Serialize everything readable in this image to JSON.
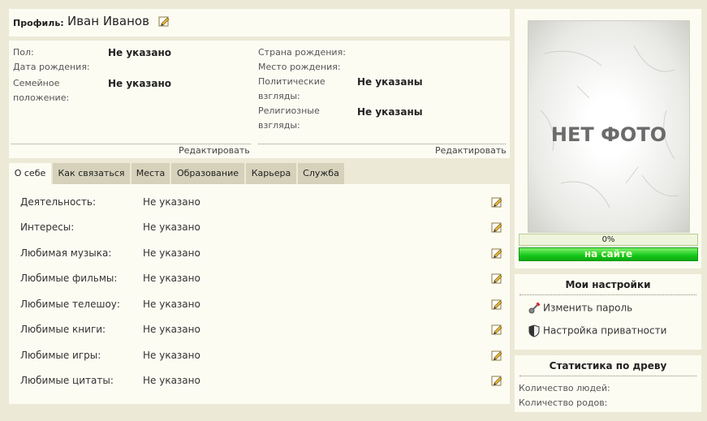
{
  "header": {
    "label": "Профиль:",
    "name": "Иван Иванов"
  },
  "info": {
    "left": [
      {
        "label": "Пол:",
        "value": "Не указано"
      },
      {
        "label": "Дата рождения:",
        "value": ""
      },
      {
        "label": "Семейное положение:",
        "value": "Не указано"
      }
    ],
    "right": [
      {
        "label": "Страна рождения:",
        "value": ""
      },
      {
        "label": "Место рождения:",
        "value": ""
      },
      {
        "label": "Политические взгляды:",
        "value": "Не указаны"
      },
      {
        "label": "Религиозные взгляды:",
        "value": "Не указаны"
      }
    ],
    "edit_left": "Редактировать",
    "edit_right": "Редактировать"
  },
  "tabs": [
    "О себе",
    "Как связаться",
    "Места",
    "Образование",
    "Карьера",
    "Служба"
  ],
  "about": [
    {
      "label": "Деятельность:",
      "value": "Не указано"
    },
    {
      "label": "Интересы:",
      "value": "Не указано"
    },
    {
      "label": "Любимая музыка:",
      "value": "Не указано"
    },
    {
      "label": "Любимые фильмы:",
      "value": "Не указано"
    },
    {
      "label": "Любимые телешоу:",
      "value": "Не указано"
    },
    {
      "label": "Любимые книги:",
      "value": "Не указано"
    },
    {
      "label": "Любимые игры:",
      "value": "Не указано"
    },
    {
      "label": "Любимые цитаты:",
      "value": "Не указано"
    }
  ],
  "photo": {
    "placeholder": "НЕТ ФОТО",
    "progress": "0%",
    "status": "на сайте"
  },
  "settings": {
    "title": "Мои настройки",
    "change_password": "Изменить пароль",
    "privacy": "Настройка приватности"
  },
  "stats": {
    "title": "Статистика по древу",
    "people": "Количество людей:",
    "families": "Количество родов:"
  },
  "colors": {
    "background": "#ece9d6",
    "panel": "#fdfcf3",
    "tab": "#d5d1ba",
    "online": "#14c81a"
  },
  "icons": {
    "edit": "pencil-icon",
    "password": "key-icon",
    "privacy": "shield-icon"
  }
}
